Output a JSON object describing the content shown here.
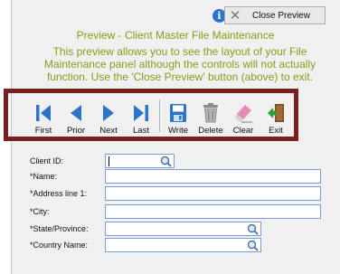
{
  "header": {
    "info_icon": "info-icon",
    "close_button_label": "Close Preview"
  },
  "preview": {
    "title": "Preview - Client Master File Maintenance",
    "description": "This preview allows you to see the layout of your File Maintenance panel although the controls will not actually function.  Use the 'Close Preview'  button (above) to exit."
  },
  "toolbar": {
    "buttons": [
      {
        "label": "First",
        "icon": "first-icon"
      },
      {
        "label": "Prior",
        "icon": "prior-icon"
      },
      {
        "label": "Next",
        "icon": "next-icon"
      },
      {
        "label": "Last",
        "icon": "last-icon"
      },
      {
        "label": "Write",
        "icon": "save-icon"
      },
      {
        "label": "Delete",
        "icon": "trash-icon"
      },
      {
        "label": "Clear",
        "icon": "eraser-icon"
      },
      {
        "label": "Exit",
        "icon": "exit-icon"
      }
    ]
  },
  "form": {
    "fields": [
      {
        "label": "Client ID:",
        "value": ""
      },
      {
        "label": "*Name:",
        "value": ""
      },
      {
        "label": "*Address line 1:",
        "value": ""
      },
      {
        "label": "*City:",
        "value": ""
      },
      {
        "label": "*State/Province:",
        "value": ""
      },
      {
        "label": "*Country Name:",
        "value": ""
      }
    ]
  },
  "colors": {
    "accent_text": "#8c9a1a",
    "highlight_border": "#7a1f1f",
    "nav_blue": "#2b74c9"
  }
}
